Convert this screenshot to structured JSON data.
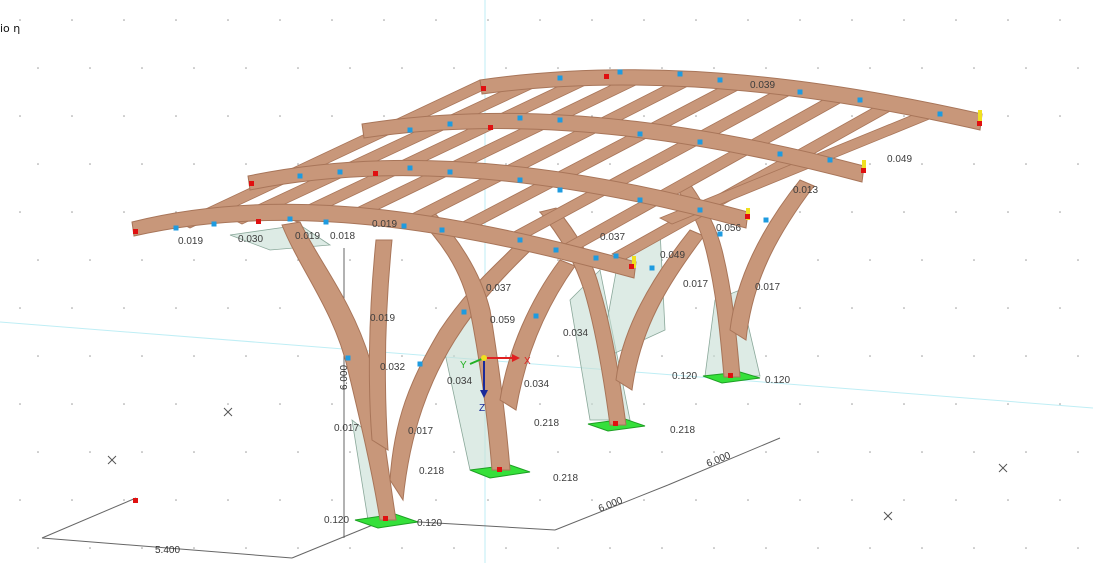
{
  "view": {
    "corner_label": "io η",
    "colors": {
      "beam": "#c8977a",
      "beam_edge": "#a87559",
      "beam_light": "#d9ad93",
      "node_blue": "#1e9be0",
      "node_red": "#e01010",
      "support": "#35e03a",
      "diagram": "#c7ddd4",
      "diagram_edge": "#8aa89a",
      "axis_x": "#e02020",
      "axis_y": "#22b022",
      "axis_z": "#1a2a9a",
      "dim_line": "#666666",
      "value_text": "#3c3c3c"
    }
  },
  "axes": {
    "x": "X",
    "y": "Y",
    "z": "Z"
  },
  "dimensions": {
    "height": "6.000",
    "length_a": "5.400",
    "length_b": "6.000",
    "length_c": "6.000"
  },
  "values": [
    "0.019",
    "0.019",
    "0.019",
    "0.018",
    "0.019",
    "0.032",
    "0.017",
    "0.017",
    "0.037",
    "0.059",
    "0.034",
    "0.034",
    "0.034",
    "0.017",
    "0.017",
    "0.049",
    "0.120",
    "0.120",
    "0.218",
    "0.218",
    "0.218",
    "0.218",
    "0.120",
    "0.120",
    "0.049",
    "0.013",
    "0.056",
    "0.037",
    "0.030",
    "0.039"
  ]
}
